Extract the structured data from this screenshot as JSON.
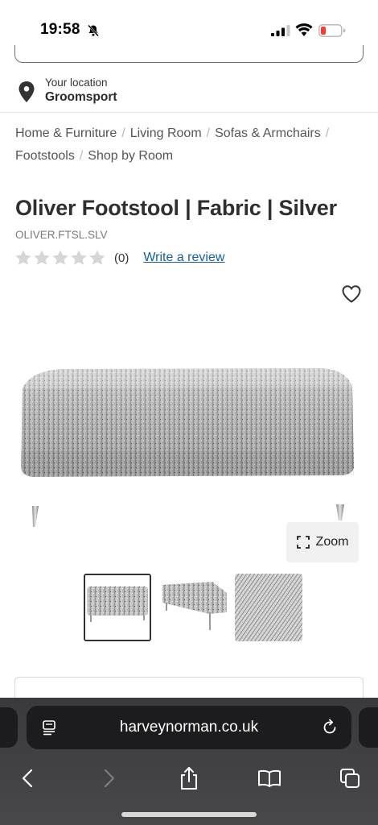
{
  "status_bar": {
    "time": "19:58",
    "icons": [
      "bell-slash-icon",
      "cellular-signal-icon",
      "wifi-icon",
      "battery-low-icon"
    ],
    "battery_color": "#ff3b30"
  },
  "location": {
    "label": "Your location",
    "value": "Groomsport",
    "icon": "location-pin-icon"
  },
  "breadcrumb": [
    "Home & Furniture",
    "Living Room",
    "Sofas & Armchairs",
    "Footstools",
    "Shop by Room"
  ],
  "product": {
    "title": "Oliver Footstool | Fabric | Silver",
    "sku": "OLIVER.FTSL.SLV",
    "rating": 0,
    "rating_max": 5,
    "rating_count": "(0)",
    "review_link": "Write a review",
    "zoom_label": "Zoom"
  },
  "thumbnails": [
    {
      "name": "front view",
      "selected": true
    },
    {
      "name": "angled view",
      "selected": false
    },
    {
      "name": "fabric swatch",
      "selected": false
    }
  ],
  "browser": {
    "url": "harveynorman.co.uk",
    "toolbar_icons": [
      "back-icon",
      "forward-icon",
      "share-icon",
      "bookmarks-icon",
      "tabs-icon"
    ]
  },
  "colors": {
    "link": "#1a5d9a",
    "text": "#2a2a2a",
    "toolbar": "#3a3a3c"
  }
}
